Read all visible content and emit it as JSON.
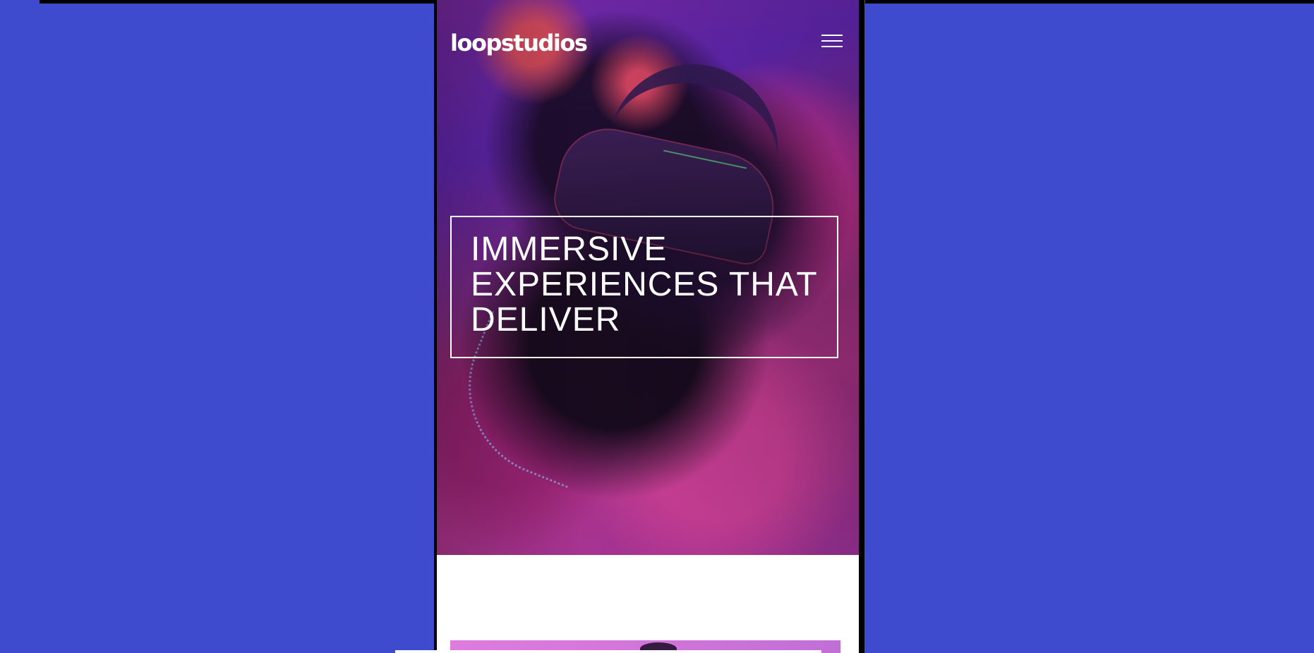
{
  "app": {
    "brand": "loopstudios"
  },
  "navigation": {
    "menu_icon": "hamburger-icon"
  },
  "hero": {
    "headline": "IMMERSIVE EXPERIENCES THAT DELIVER"
  },
  "colors": {
    "page_background": "#3f4bce",
    "device_frame": "#000000",
    "hero_text": "#ffffff",
    "content_background": "#ffffff",
    "next_card_accent": "#d275da"
  }
}
